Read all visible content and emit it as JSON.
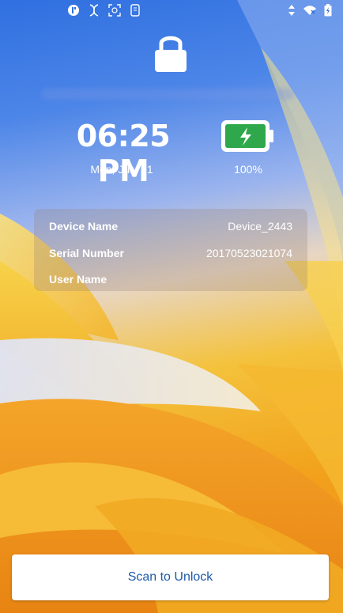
{
  "status_bar": {
    "left_icons": [
      "app-badge-icon",
      "dna-icon",
      "face-scan-icon",
      "phone-screen-icon"
    ],
    "right_icons": [
      "data-transfer-icon",
      "wifi-icon",
      "battery-charging-icon"
    ]
  },
  "lock_screen": {
    "time": "06:25 PM",
    "date": "Mon, July 21",
    "battery_percent": "100%",
    "battery_level": 1.0
  },
  "device_info": {
    "rows": [
      {
        "label": "Device Name",
        "value": "Device_2443"
      },
      {
        "label": "Serial Number",
        "value": "20170523021074"
      },
      {
        "label": "User Name",
        "value": ""
      }
    ]
  },
  "actions": {
    "scan_label": "Scan to Unlock"
  },
  "colors": {
    "accent_blue": "#1e5aa8",
    "battery_green": "#2ea84a"
  }
}
